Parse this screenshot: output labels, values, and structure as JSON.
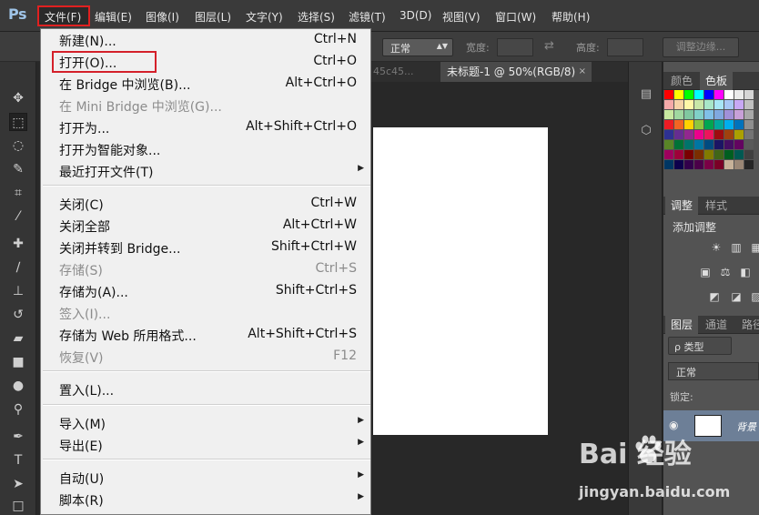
{
  "app": {
    "logo": "Ps"
  },
  "menubar": {
    "items": [
      {
        "label": "文件(F)"
      },
      {
        "label": "编辑(E)"
      },
      {
        "label": "图像(I)"
      },
      {
        "label": "图层(L)"
      },
      {
        "label": "文字(Y)"
      },
      {
        "label": "选择(S)"
      },
      {
        "label": "滤镜(T)"
      },
      {
        "label": "3D(D)"
      },
      {
        "label": "视图(V)"
      },
      {
        "label": "窗口(W)"
      },
      {
        "label": "帮助(H)"
      }
    ]
  },
  "options": {
    "mode_value": "正常",
    "width_label": "宽度:",
    "height_label": "高度:",
    "refine_button": "调整边缘..."
  },
  "tabs": {
    "previous_partial": "45c45...",
    "active": "未标题-1 @ 50%(RGB/8)",
    "close_glyph": "×"
  },
  "file_menu": {
    "items": [
      {
        "label": "新建(N)...",
        "shortcut": "Ctrl+N",
        "enabled": true
      },
      {
        "label": "打开(O)...",
        "shortcut": "Ctrl+O",
        "enabled": true,
        "highlighted": true
      },
      {
        "label": "在 Bridge 中浏览(B)...",
        "shortcut": "Alt+Ctrl+O",
        "enabled": true
      },
      {
        "label": "在 Mini Bridge 中浏览(G)...",
        "shortcut": "",
        "enabled": false
      },
      {
        "label": "打开为...",
        "shortcut": "Alt+Shift+Ctrl+O",
        "enabled": true
      },
      {
        "label": "打开为智能对象...",
        "shortcut": "",
        "enabled": true
      },
      {
        "label": "最近打开文件(T)",
        "shortcut": "",
        "enabled": true,
        "submenu": true
      },
      {
        "label": "关闭(C)",
        "shortcut": "Ctrl+W",
        "enabled": true
      },
      {
        "label": "关闭全部",
        "shortcut": "Alt+Ctrl+W",
        "enabled": true
      },
      {
        "label": "关闭并转到 Bridge...",
        "shortcut": "Shift+Ctrl+W",
        "enabled": true
      },
      {
        "label": "存储(S)",
        "shortcut": "Ctrl+S",
        "enabled": false
      },
      {
        "label": "存储为(A)...",
        "shortcut": "Shift+Ctrl+S",
        "enabled": true
      },
      {
        "label": "签入(I)...",
        "shortcut": "",
        "enabled": false
      },
      {
        "label": "存储为 Web 所用格式...",
        "shortcut": "Alt+Shift+Ctrl+S",
        "enabled": true
      },
      {
        "label": "恢复(V)",
        "shortcut": "F12",
        "enabled": false
      },
      {
        "label": "置入(L)...",
        "shortcut": "",
        "enabled": true
      },
      {
        "label": "导入(M)",
        "shortcut": "",
        "enabled": true,
        "submenu": true
      },
      {
        "label": "导出(E)",
        "shortcut": "",
        "enabled": true,
        "submenu": true
      },
      {
        "label": "自动(U)",
        "shortcut": "",
        "enabled": true,
        "submenu": true
      },
      {
        "label": "脚本(R)",
        "shortcut": "",
        "enabled": true,
        "submenu": true
      }
    ],
    "submenu_glyph": "▶"
  },
  "panels": {
    "color_tabs": [
      "颜色",
      "色板"
    ],
    "adjust_tabs": [
      "调整",
      "样式"
    ],
    "adjust_title": "添加调整",
    "layers_tabs": [
      "图层",
      "通道",
      "路径"
    ],
    "kind_value": "ρ 类型",
    "blend_value": "正常",
    "lock_label": "锁定:",
    "layer_name": "背景"
  },
  "swatch_colors": [
    [
      "#ff0000",
      "#ffff00",
      "#00ff00",
      "#00ffff",
      "#0000ff",
      "#ff00ff",
      "#ffffff",
      "#ebebeb",
      "#d6d6d6"
    ],
    [
      "#f5a9a9",
      "#f6d3a8",
      "#fff7a8",
      "#c8e6a8",
      "#a8e6c8",
      "#a8e6f5",
      "#a8c8f5",
      "#c8a8f5",
      "#c0c0c0"
    ],
    [
      "#c8e8a0",
      "#a0d8a0",
      "#80c8a0",
      "#80d0c8",
      "#80c0e8",
      "#80a8e0",
      "#a090d8",
      "#c8a0d8",
      "#a8a8a8"
    ],
    [
      "#ed1c24",
      "#f26522",
      "#ffd200",
      "#8dc63f",
      "#00a651",
      "#00a99d",
      "#00aeef",
      "#0072bc",
      "#8f8f8f"
    ],
    [
      "#2e3192",
      "#662d91",
      "#92278f",
      "#ec008c",
      "#ed145b",
      "#9e0b0f",
      "#a0410d",
      "#aba000",
      "#737373"
    ],
    [
      "#598527",
      "#007236",
      "#00746b",
      "#0076a3",
      "#004b80",
      "#1b1464",
      "#440e62",
      "#630460",
      "#595959"
    ],
    [
      "#9e005d",
      "#9e0039",
      "#790000",
      "#7b2e00",
      "#827b00",
      "#406618",
      "#005e20",
      "#005952",
      "#404040"
    ],
    [
      "#003663",
      "#0d004c",
      "#32004b",
      "#4b0049",
      "#7b0046",
      "#7a0026",
      "#c7b299",
      "#998675",
      "#262626"
    ]
  ],
  "watermark": {
    "text": "Bai  经验",
    "url": "jingyan.baidu.com"
  }
}
